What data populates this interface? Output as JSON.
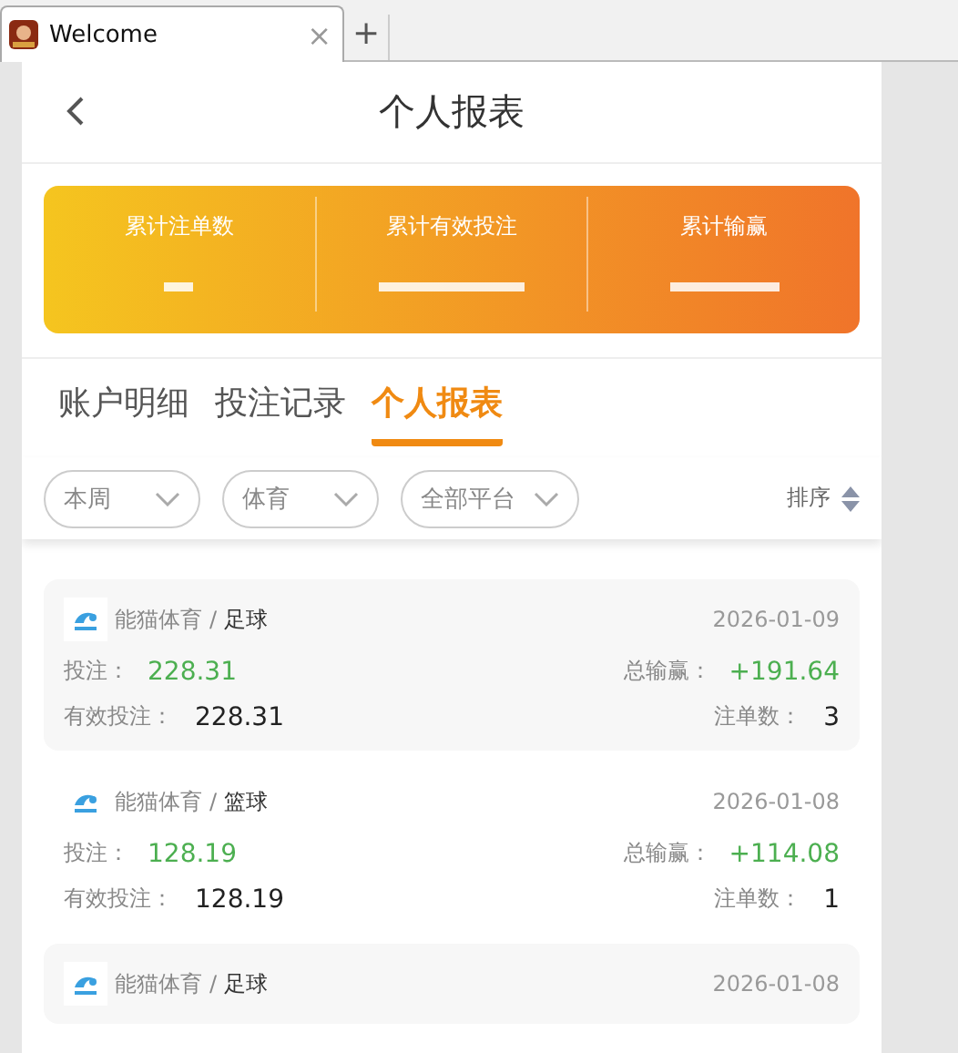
{
  "browser": {
    "tab_title": "Welcome",
    "close": "×",
    "new_tab": "+"
  },
  "header": {
    "title": "个人报表"
  },
  "summary": [
    {
      "label": "累计注单数"
    },
    {
      "label": "累计有效投注"
    },
    {
      "label": "累计输赢"
    }
  ],
  "tabs": [
    {
      "label": "账户明细",
      "selected": false
    },
    {
      "label": "投注记录",
      "selected": false
    },
    {
      "label": "个人报表",
      "selected": true
    }
  ],
  "filters": [
    {
      "label": "本周"
    },
    {
      "label": "体育"
    },
    {
      "label": "全部平台"
    }
  ],
  "sort": {
    "label": "排序"
  },
  "records": [
    {
      "platform": "能猫体育",
      "separator": "/",
      "sport": "足球",
      "date": "2026-01-09",
      "bet_label": "投注：",
      "bet": "228.31",
      "win_label": "总输赢：",
      "win": "+191.64",
      "valid_label": "有效投注：",
      "valid": "228.31",
      "count_label": "注单数：",
      "count": "3"
    },
    {
      "platform": "能猫体育",
      "separator": "/",
      "sport": "篮球",
      "date": "2026-01-08",
      "bet_label": "投注：",
      "bet": "128.19",
      "win_label": "总输赢：",
      "win": "+114.08",
      "valid_label": "有效投注：",
      "valid": "128.19",
      "count_label": "注单数：",
      "count": "1"
    },
    {
      "platform": "能猫体育",
      "separator": "/",
      "sport": "足球",
      "date": "2026-01-08"
    }
  ]
}
